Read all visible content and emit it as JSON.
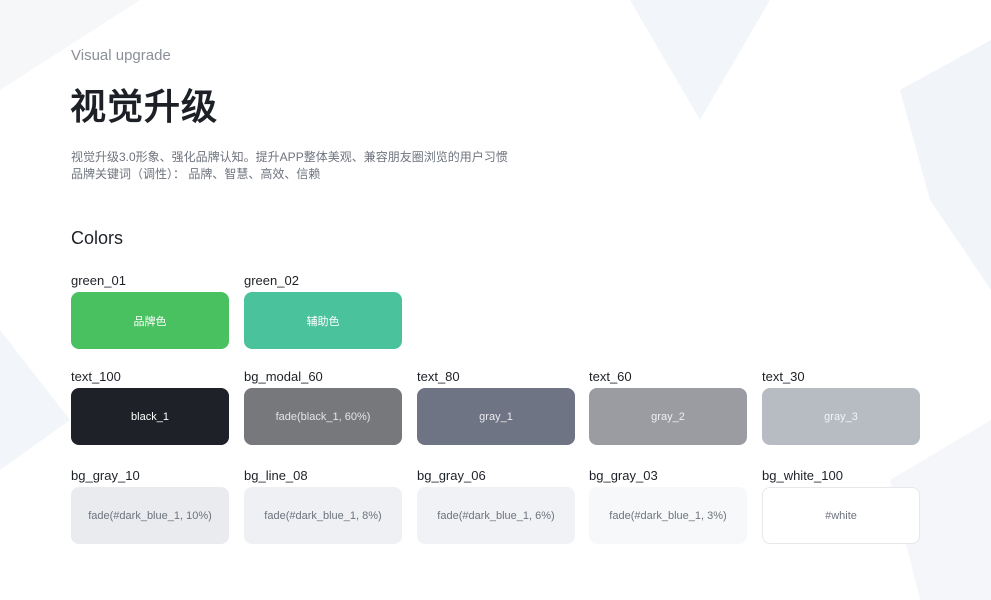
{
  "header": {
    "eyebrow": "Visual upgrade",
    "title": "视觉升级",
    "desc_line1": "视觉升级3.0形象、强化品牌认知。提升APP整体美观、兼容朋友圈浏览的用户习惯",
    "desc_line2": "品牌关键词（调性）：  品牌、智慧、高效、信赖"
  },
  "colors": {
    "section_title": "Colors",
    "row1": [
      {
        "name": "green_01",
        "label": "品牌色",
        "color": "#4ac161",
        "text_color": "#ffffff"
      },
      {
        "name": "green_02",
        "label": "辅助色",
        "color": "#4ac29b",
        "text_color": "#ffffff"
      }
    ],
    "row2": [
      {
        "name": "text_100",
        "label": "black_1",
        "color": "#1e2127",
        "text_color": "#ffffff"
      },
      {
        "name": "bg_modal_60",
        "label": "fade(black_1, 60%)",
        "color": "#77787b",
        "text_color": "#e4e5e7"
      },
      {
        "name": "text_80",
        "label": "gray_1",
        "color": "#6e7484",
        "text_color": "#e9eaee"
      },
      {
        "name": "text_60",
        "label": "gray_2",
        "color": "#9a9ca2",
        "text_color": "#eeeff1"
      },
      {
        "name": "text_30",
        "label": "gray_3",
        "color": "#b7bcc3",
        "text_color": "#f2f3f5"
      }
    ],
    "row3": [
      {
        "name": "bg_gray_10",
        "label": "fade(#dark_blue_1, 10%)",
        "color": "#e9ebee",
        "text_color": "#6e737d"
      },
      {
        "name": "bg_line_08",
        "label": "fade(#dark_blue_1, 8%)",
        "color": "#eef0f3",
        "text_color": "#6e737d"
      },
      {
        "name": "bg_gray_06",
        "label": "fade(#dark_blue_1, 6%)",
        "color": "#f1f2f5",
        "text_color": "#6e737d"
      },
      {
        "name": "bg_gray_03",
        "label": "fade(#dark_blue_1, 3%)",
        "color": "#f7f8f9",
        "text_color": "#6e737d"
      },
      {
        "name": "bg_white_100",
        "label": "#white",
        "color": "#ffffff",
        "text_color": "#6e737d",
        "border": "#e6e8ec"
      }
    ]
  }
}
